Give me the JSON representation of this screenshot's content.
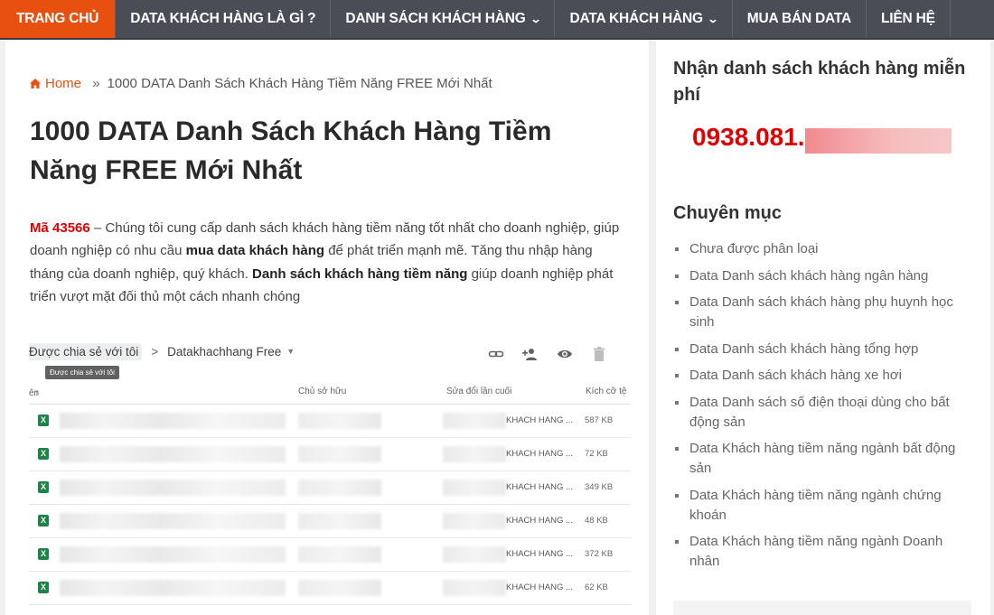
{
  "nav": {
    "items": [
      {
        "label": "TRANG CHỦ",
        "active": true,
        "dropdown": false
      },
      {
        "label": "DATA KHÁCH HÀNG LÀ GÌ ?",
        "active": false,
        "dropdown": false
      },
      {
        "label": "DANH SÁCH KHÁCH HÀNG",
        "active": false,
        "dropdown": true
      },
      {
        "label": "DATA KHÁCH HÀNG",
        "active": false,
        "dropdown": true
      },
      {
        "label": "MUA BÁN DATA",
        "active": false,
        "dropdown": false
      },
      {
        "label": "LIÊN HỆ",
        "active": false,
        "dropdown": false
      }
    ],
    "dropdown_glyph": "⌄"
  },
  "breadcrumb": {
    "home": "Home",
    "separator": "»",
    "current": "1000 DATA Danh Sách Khách Hàng Tiềm Năng FREE Mới Nhất"
  },
  "article": {
    "title": "1000 DATA Danh Sách Khách Hàng Tiềm Năng FREE Mới Nhất",
    "intro": {
      "code": "Mã 43566",
      "p1": " – Chúng tôi cung cấp danh sách khách hàng tiềm năng tốt nhất cho doanh nghiệp, giúp doanh nghiệp có nhu cầu ",
      "b1": "mua data khách hàng",
      "p2": " để phát triển mạnh mẽ. Tăng thu nhập hàng tháng của doanh nghiệp, quý khách. ",
      "b2": "Danh sách khách hàng tiềm năng",
      "p3": " giúp doanh nghiệp phát triển vượt mặt đối thủ một cách nhanh chóng"
    }
  },
  "drive": {
    "path_root": "Được chia sẻ với tôi",
    "path_sep": ">",
    "path_folder": "Datakhachhang Free",
    "tooltip": "Được chia sẻ với tôi",
    "columns": {
      "name": "ên",
      "owner": "Chủ sở hữu",
      "modified": "Sửa đổi lần cuối",
      "size": "Kích cỡ tệ"
    },
    "sort_arrow": "↑",
    "file_icon_letter": "X",
    "rows": [
      {
        "owner": "KHACH HANG ...",
        "size": "587 KB"
      },
      {
        "owner": "KHACH HANG ...",
        "size": "72 KB"
      },
      {
        "owner": "KHACH HANG ...",
        "size": "349 KB"
      },
      {
        "owner": "KHACH HANG ...",
        "size": "48 KB"
      },
      {
        "owner": "KHACH HANG ...",
        "size": "372 KB"
      },
      {
        "owner": "KHACH HANG ...",
        "size": "62 KB"
      }
    ]
  },
  "sidebar": {
    "free_heading": "Nhận danh sách khách hàng miễn phí",
    "phone": "0938.081.",
    "categories_heading": "Chuyên mục",
    "categories": [
      "Chưa được phân loại",
      "Data Danh sách khách hàng ngân hàng",
      "Data Danh sách khách hàng phụ huynh học sinh",
      "Data Danh sách khách hàng tổng hợp",
      "Data Danh sách khách hàng xe hơi",
      "Data Danh sách số điện thoại dùng cho bất động sản",
      "Data Khách hàng tiềm năng ngành bất động sản",
      "Data Khách hàng tiềm năng ngành chứng khoán",
      "Data Khách hàng tiềm năng ngành Doanh nhân"
    ]
  },
  "colors": {
    "accent": "#e8500f",
    "nav_bg": "#4a4d55",
    "phone_red": "#e00000",
    "excel_green": "#1d8348"
  }
}
